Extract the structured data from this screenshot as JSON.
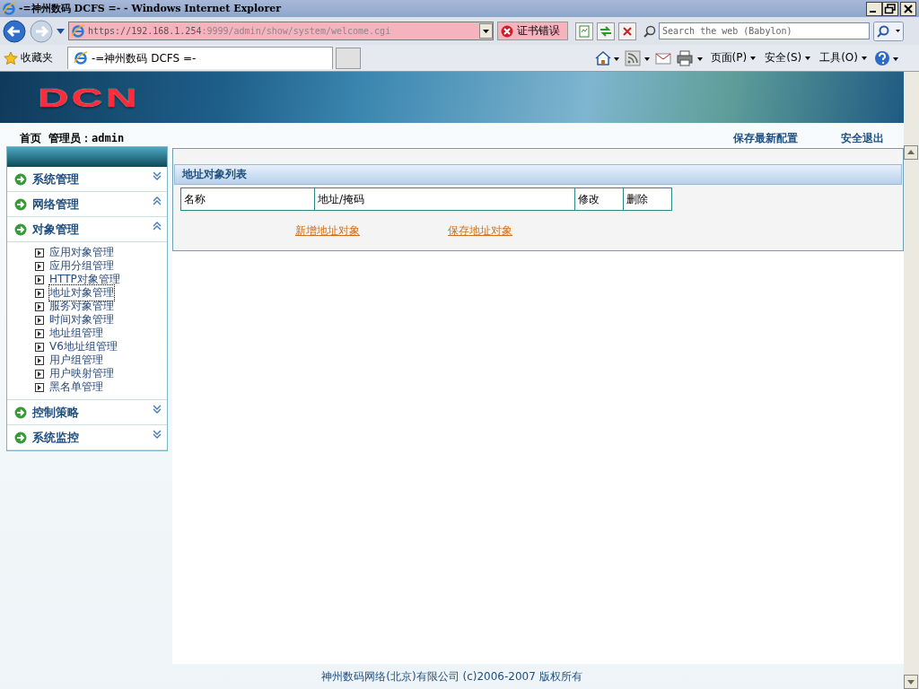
{
  "window": {
    "title": "-=神州数码 DCFS =- - Windows Internet Explorer"
  },
  "address_bar": {
    "url_host": "https://192.168.1.254",
    "url_path": ":9999/admin/show/system/welcome.cgi",
    "cert_error": "证书错误"
  },
  "search": {
    "placeholder": "Search the web (Babylon)"
  },
  "favorites": {
    "label": "收藏夹"
  },
  "tabs": [
    {
      "label": "-=神州数码 DCFS =-",
      "selected": true
    }
  ],
  "command_bar": [
    {
      "label": "页面(P)",
      "kind": "menu"
    },
    {
      "label": "安全(S)",
      "kind": "menu"
    },
    {
      "label": "工具(O)",
      "kind": "menu"
    }
  ],
  "page": {
    "logo": "DCN",
    "breadcrumb": {
      "home": "首页",
      "user": "管理员：admin"
    },
    "header_links": [
      "保存最新配置",
      "安全退出"
    ],
    "sidebar": [
      {
        "label": "系统管理",
        "expanded": false
      },
      {
        "label": "网络管理",
        "expanded": true
      },
      {
        "label": "对象管理",
        "expanded": true,
        "children": [
          {
            "label": "应用对象管理",
            "selected": false
          },
          {
            "label": "应用分组管理",
            "selected": false
          },
          {
            "label": "HTTP对象管理",
            "selected": false
          },
          {
            "label": "地址对象管理",
            "selected": true
          },
          {
            "label": "服务对象管理",
            "selected": false
          },
          {
            "label": "时间对象管理",
            "selected": false
          },
          {
            "label": "地址组管理",
            "selected": false
          },
          {
            "label": "V6地址组管理",
            "selected": false
          },
          {
            "label": "用户组管理",
            "selected": false
          },
          {
            "label": "用户映射管理",
            "selected": false
          },
          {
            "label": "黑名单管理",
            "selected": false
          }
        ]
      },
      {
        "label": "控制策略",
        "expanded": false
      },
      {
        "label": "系统监控",
        "expanded": false
      }
    ],
    "panel": {
      "title": "地址对象列表",
      "columns": [
        "名称",
        "地址/掩码",
        "修改",
        "删除"
      ],
      "actions": [
        "新增地址对象",
        "保存地址对象"
      ]
    },
    "footer": "神州数码网络(北京)有限公司 (c)2006-2007 版权所有"
  }
}
